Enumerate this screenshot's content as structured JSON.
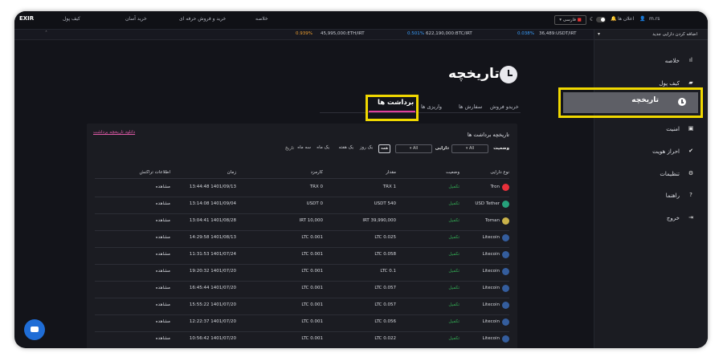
{
  "topnav": {
    "logo": "EXIR",
    "items": [
      "کیف پول",
      "خرید آسان",
      "خرید و فروش حرفه ای",
      "خلاصه"
    ],
    "language": "فارسی",
    "notifications": "اعلان ها",
    "user": "m.rs"
  },
  "ticker": [
    {
      "pair": "0.939%",
      "price": "45,995,000:ETH/IRT",
      "pct_class": "orange"
    },
    {
      "pair": "0.501%",
      "price": "622,190,000:BTC/IRT",
      "pct_class": "up"
    },
    {
      "pair": "0.038%",
      "price": "36,489:USDT/IRT",
      "pct_class": "up"
    }
  ],
  "sidebar": {
    "add_asset": "اضافه کردن دارایی جدید",
    "items": [
      {
        "label": "خلاصه",
        "icon": "chart-bars-icon",
        "glyph": "▮"
      },
      {
        "label": "کیف پول",
        "icon": "wallet-icon",
        "glyph": "▰"
      },
      {
        "label": "تاریخچه",
        "icon": "clock-icon",
        "glyph": "◷"
      },
      {
        "label": "امنیت",
        "icon": "lock-icon",
        "glyph": "🔒"
      },
      {
        "label": "احراز هویت",
        "icon": "check-circle-icon",
        "glyph": "✔"
      },
      {
        "label": "تنظیمات",
        "icon": "gear-icon",
        "glyph": "⚙"
      },
      {
        "label": "راهنما",
        "icon": "help-icon",
        "glyph": "?"
      },
      {
        "label": "خروج",
        "icon": "logout-icon",
        "glyph": "⇥"
      }
    ]
  },
  "page": {
    "title": "تاریخچه",
    "tabs": [
      "خریدو فروش",
      "سفارش ها",
      "واریزی ها",
      "برداشت ها"
    ]
  },
  "panel": {
    "title": "تاریخچه برداشت ها",
    "download_link": "دانلود تاریخچه برداشت",
    "filters": {
      "asset_label": "دارایی",
      "asset_value": "All",
      "status_label": "وضعیت",
      "status_value": "All",
      "ranges": [
        "همه",
        "یک روز",
        "یک هفته",
        "یک ماه",
        "سه ماه"
      ],
      "date_label": "تاریخ"
    },
    "columns": [
      "نوع دارایی",
      "وضعیت",
      "مقدار",
      "کارمزد",
      "زمان",
      "اطلاعات تراکنش"
    ],
    "rows": [
      {
        "coin": "Tron",
        "status": "تکمیل",
        "amount": "TRX 1",
        "fee": "TRX 0",
        "time": "13:44:48 1401/09/13",
        "info": "مشاهده",
        "color": "#e8303a"
      },
      {
        "coin": "USD Tether",
        "status": "تکمیل",
        "amount": "USDT 540",
        "fee": "USDT 0",
        "time": "13:14:08 1401/09/04",
        "info": "مشاهده",
        "color": "#26a17b"
      },
      {
        "coin": "Toman",
        "status": "تکمیل",
        "amount": "IRT 39,990,000",
        "fee": "IRT 10,000",
        "time": "13:04:41 1401/08/28",
        "info": "مشاهده",
        "color": "#c9b24a"
      },
      {
        "coin": "Litecoin",
        "status": "تکمیل",
        "amount": "LTC 0.025",
        "fee": "LTC 0.001",
        "time": "14:29:58 1401/08/13",
        "info": "مشاهده",
        "color": "#345d9d"
      },
      {
        "coin": "Litecoin",
        "status": "تکمیل",
        "amount": "LTC 0.058",
        "fee": "LTC 0.001",
        "time": "11:31:53 1401/07/24",
        "info": "مشاهده",
        "color": "#345d9d"
      },
      {
        "coin": "Litecoin",
        "status": "تکمیل",
        "amount": "LTC 0.1",
        "fee": "LTC 0.001",
        "time": "19:20:32 1401/07/20",
        "info": "مشاهده",
        "color": "#345d9d"
      },
      {
        "coin": "Litecoin",
        "status": "تکمیل",
        "amount": "LTC 0.057",
        "fee": "LTC 0.001",
        "time": "16:45:44 1401/07/20",
        "info": "مشاهده",
        "color": "#345d9d"
      },
      {
        "coin": "Litecoin",
        "status": "تکمیل",
        "amount": "LTC 0.057",
        "fee": "LTC 0.001",
        "time": "15:55:22 1401/07/20",
        "info": "مشاهده",
        "color": "#345d9d"
      },
      {
        "coin": "Litecoin",
        "status": "تکمیل",
        "amount": "LTC 0.056",
        "fee": "LTC 0.001",
        "time": "12:22:37 1401/07/20",
        "info": "مشاهده",
        "color": "#345d9d"
      },
      {
        "coin": "Litecoin",
        "status": "تکمیل",
        "amount": "LTC 0.022",
        "fee": "LTC 0.001",
        "time": "10:56:42 1401/07/20",
        "info": "مشاهده",
        "color": "#345d9d"
      },
      {
        "coin": "Litecoin",
        "status": "تکمیل",
        "amount": "LTC 0.051",
        "fee": "LTC 0.001",
        "time": "10:43:24 1401/07/20",
        "info": "مشاهده",
        "color": "#345d9d"
      }
    ]
  },
  "colors": {
    "accent": "#e0409c",
    "highlight": "#f0d800",
    "success": "#32a852",
    "background": "#13141a"
  }
}
